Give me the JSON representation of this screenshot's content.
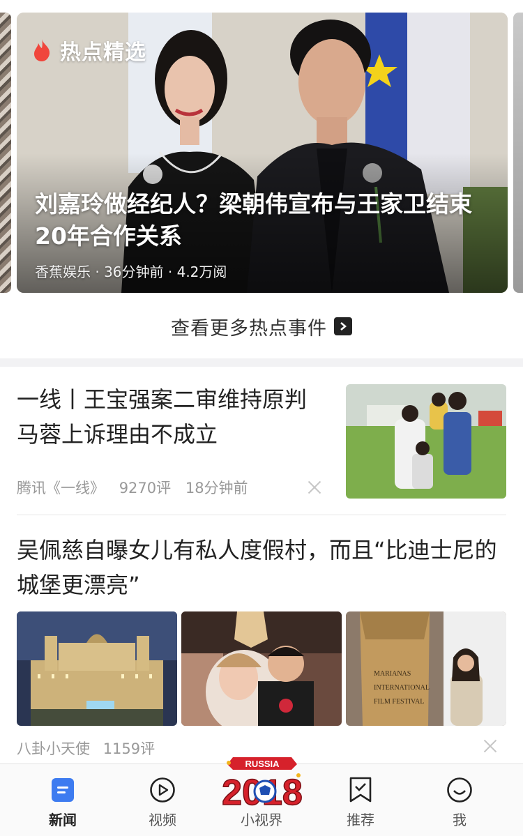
{
  "hero": {
    "tag": "热点精选",
    "title": "刘嘉玲做经纪人？梁朝伟宣布与王家卫结束20年合作关系",
    "meta": "香蕉娱乐 · 36分钟前 · 4.2万阅"
  },
  "more_hot": {
    "label": "查看更多热点事件"
  },
  "news": [
    {
      "title": "一线丨王宝强案二审维持原判 马蓉上诉理由不成立",
      "source": "腾讯《一线》",
      "comments": "9270评",
      "time": "18分钟前"
    },
    {
      "title": "吴佩慈自曝女儿有私人度假村，而且“比迪士尼的城堡更漂亮”",
      "source": "八卦小天使",
      "comments": "1159评",
      "festival_sign": "MARIANAS INTERNATIONAL FILM FESTIVAL"
    }
  ],
  "tabbar": {
    "tabs": [
      {
        "label": "新闻",
        "icon": "news-doc-icon",
        "active": true
      },
      {
        "label": "视频",
        "icon": "play-circle-icon"
      },
      {
        "label": "小视界",
        "icon": "russia-2018-logo"
      },
      {
        "label": "推荐",
        "icon": "bookmark-check-icon"
      },
      {
        "label": "我",
        "icon": "smiley-icon"
      }
    ],
    "logo_text": "RUSSIA",
    "logo_year": "2018"
  },
  "colors": {
    "accent_blue": "#3d7bf0",
    "flame_red": "#f0463c",
    "logo_red": "#d6212b"
  }
}
